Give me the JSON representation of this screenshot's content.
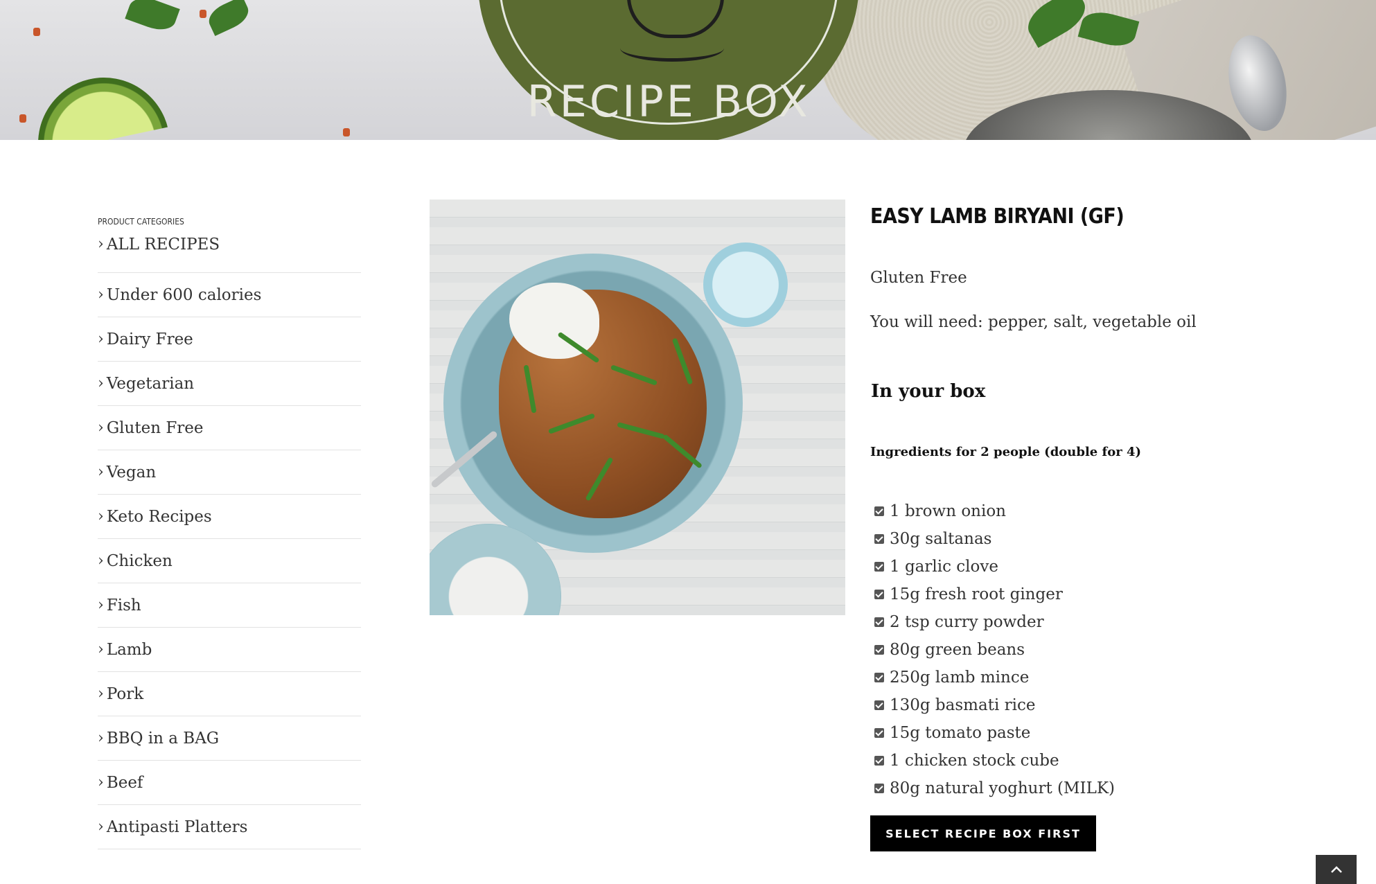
{
  "header": {
    "logo_text": "RECIPE BOX"
  },
  "sidebar": {
    "title": "PRODUCT CATEGORIES",
    "items": [
      {
        "label": "ALL RECIPES"
      },
      {
        "label": "Under 600 calories"
      },
      {
        "label": "Dairy Free"
      },
      {
        "label": "Vegetarian"
      },
      {
        "label": "Gluten Free"
      },
      {
        "label": "Vegan"
      },
      {
        "label": "Keto Recipes"
      },
      {
        "label": "Chicken"
      },
      {
        "label": "Fish"
      },
      {
        "label": "Lamb"
      },
      {
        "label": "Pork"
      },
      {
        "label": "BBQ in a BAG"
      },
      {
        "label": "Beef"
      },
      {
        "label": "Antipasti Platters"
      }
    ],
    "chevron": "›"
  },
  "product": {
    "title": "EASY LAMB BIRYANI (GF)",
    "diet": "Gluten Free",
    "you_will_need": "You will need: pepper, salt, vegetable oil",
    "box_heading": "In your box",
    "ingredients_heading": "Ingredients for 2 people (double for 4)",
    "ingredients": [
      "1 brown onion",
      "30g saltanas",
      "1 garlic clove",
      "15g fresh root ginger",
      "2 tsp curry powder",
      "80g green beans",
      "250g lamb mince",
      "130g basmati rice",
      "15g tomato paste",
      "1 chicken stock cube",
      "80g natural yoghurt (MILK)"
    ],
    "button_label": "SELECT RECIPE BOX FIRST"
  },
  "icons": {
    "scroll_top": "chevron-up-icon",
    "ingredient_check": "checkbox-checked-icon"
  },
  "colors": {
    "logo_green": "#5b6b31",
    "button_bg": "#000000",
    "scroll_top_bg": "#333333"
  }
}
